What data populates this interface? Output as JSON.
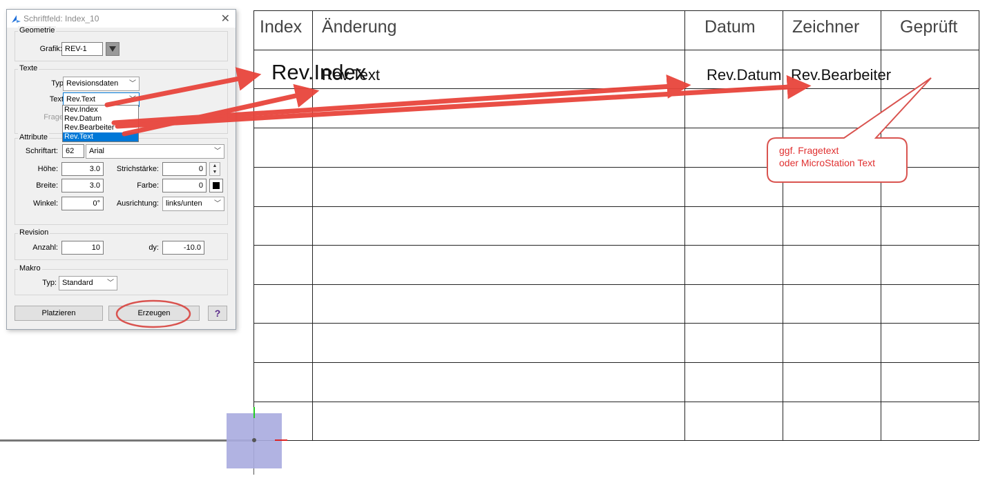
{
  "dialog": {
    "title": "Schriftfeld: Index_10",
    "geometrie": {
      "label": "Geometrie",
      "grafik_label": "Grafik:",
      "grafik_value": "REV-1"
    },
    "texte": {
      "label": "Texte",
      "typ_label": "Typ:",
      "typ_value": "Revisionsdaten",
      "text_label": "Text:",
      "text_value": "Rev.Text",
      "frage_label": "Frage:",
      "options": [
        "Rev.Index",
        "Rev.Datum",
        "Rev.Bearbeiter",
        "Rev.Text"
      ]
    },
    "attribute": {
      "label": "Attribute",
      "schriftart_label": "Schriftart:",
      "schriftart_num": "62",
      "schriftart_name": "Arial",
      "hoehe_label": "Höhe:",
      "hoehe_value": "3.0",
      "breite_label": "Breite:",
      "breite_value": "3.0",
      "winkel_label": "Winkel:",
      "winkel_value": "0°",
      "strichstaerke_label": "Strichstärke:",
      "strichstaerke_value": "0",
      "farbe_label": "Farbe:",
      "farbe_value": "0",
      "ausrichtung_label": "Ausrichtung:",
      "ausrichtung_value": "links/unten"
    },
    "revision": {
      "label": "Revision",
      "anzahl_label": "Anzahl:",
      "anzahl_value": "10",
      "dy_label": "dy:",
      "dy_value": "-10.0"
    },
    "makro": {
      "label": "Makro",
      "typ_label": "Typ:",
      "typ_value": "Standard"
    },
    "buttons": {
      "platzieren": "Platzieren",
      "erzeugen": "Erzeugen",
      "help": "?"
    }
  },
  "table": {
    "headers": [
      "Index",
      "Änderung",
      "Datum",
      "Zeichner",
      "Geprüft"
    ],
    "placed_texts": [
      "Rev.Index",
      "Rev.Text",
      "Rev.Datum",
      "Rev.Bearbeiter"
    ]
  },
  "callout": {
    "line1": "ggf. Fragetext",
    "line2": "oder MicroStation Text"
  },
  "colors": {
    "annotation_red": "#e8453c",
    "selection_blue": "#0078d7",
    "cursor_box": "#a9abdf"
  }
}
